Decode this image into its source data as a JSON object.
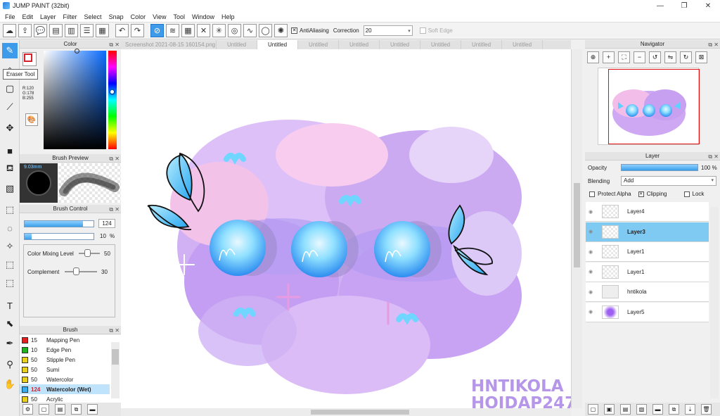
{
  "window": {
    "title": "JUMP PAINT (32bit)",
    "minimize": "—",
    "maximize": "❐",
    "close": "✕"
  },
  "menu": [
    "File",
    "Edit",
    "Layer",
    "Filter",
    "Select",
    "Snap",
    "Color",
    "View",
    "Tool",
    "Window",
    "Help"
  ],
  "toolbar": {
    "antialiasing_label": "AntiAliasing",
    "antialiasing_checked": "✕",
    "correction_label": "Correction",
    "correction_value": "20",
    "soft_edge_label": "Soft Edge"
  },
  "tooltip": "Eraser Tool",
  "color_panel": {
    "title": "Color",
    "r": "R:120",
    "g": "G:178",
    "b": "B:255",
    "current_color": "#78b2ff"
  },
  "brush_preview": {
    "title": "Brush Preview",
    "size": "9.03mm"
  },
  "brush_control": {
    "title": "Brush Control",
    "size_value": "124",
    "size_fraction": 0.85,
    "opacity_value": "10",
    "opacity_unit": "%",
    "opacity_fraction": 0.1,
    "color_mixing_label": "Color Mixing Level",
    "color_mixing_value": "50",
    "complement_label": "Complement",
    "complement_value": "30"
  },
  "brush_list": {
    "title": "Brush",
    "items": [
      {
        "size": "15",
        "name": "Mapping Pen",
        "color": "#e02020"
      },
      {
        "size": "10",
        "name": "Edge Pen",
        "color": "#20b020"
      },
      {
        "size": "50",
        "name": "Stipple Pen",
        "color": "#e8d020"
      },
      {
        "size": "50",
        "name": "Sumi",
        "color": "#e8d020"
      },
      {
        "size": "50",
        "name": "Watercolor",
        "color": "#e8d020"
      },
      {
        "size": "124",
        "name": "Watercolor (Wet)",
        "color": "#3aaeea"
      },
      {
        "size": "50",
        "name": "Acrylic",
        "color": "#e8d020"
      }
    ]
  },
  "tabs": [
    "Screenshot 2021-08-15 160154.png",
    "Untitled",
    "Untitled",
    "Untitled",
    "Untitled",
    "Untitled",
    "Untitled",
    "Untitled",
    "Untitled"
  ],
  "active_tab": 2,
  "artwork": {
    "signature_line1": "HNTIKOLA",
    "signature_line2": "HOIDAP247"
  },
  "navigator": {
    "title": "Navigator"
  },
  "layer_panel": {
    "title": "Layer",
    "opacity_label": "Opacity",
    "opacity_value": "100 %",
    "opacity_fraction": 1.0,
    "blending_label": "Blending",
    "blending_value": "Add",
    "protect_alpha_label": "Protect Alpha",
    "clipping_label": "Clipping",
    "clipping_checked": "✕",
    "lock_label": "Lock",
    "layers": [
      {
        "name": "Layer4",
        "selected": false
      },
      {
        "name": "Layer3",
        "selected": true
      },
      {
        "name": "Layer1",
        "selected": false
      },
      {
        "name": "Layer1",
        "selected": false
      },
      {
        "name": "hntikola",
        "selected": false
      },
      {
        "name": "Layer5",
        "selected": false
      }
    ]
  },
  "colors": {
    "accent": "#3d9be9",
    "selected_layer": "#7fcaf3",
    "nav_frame": "#e01010"
  }
}
